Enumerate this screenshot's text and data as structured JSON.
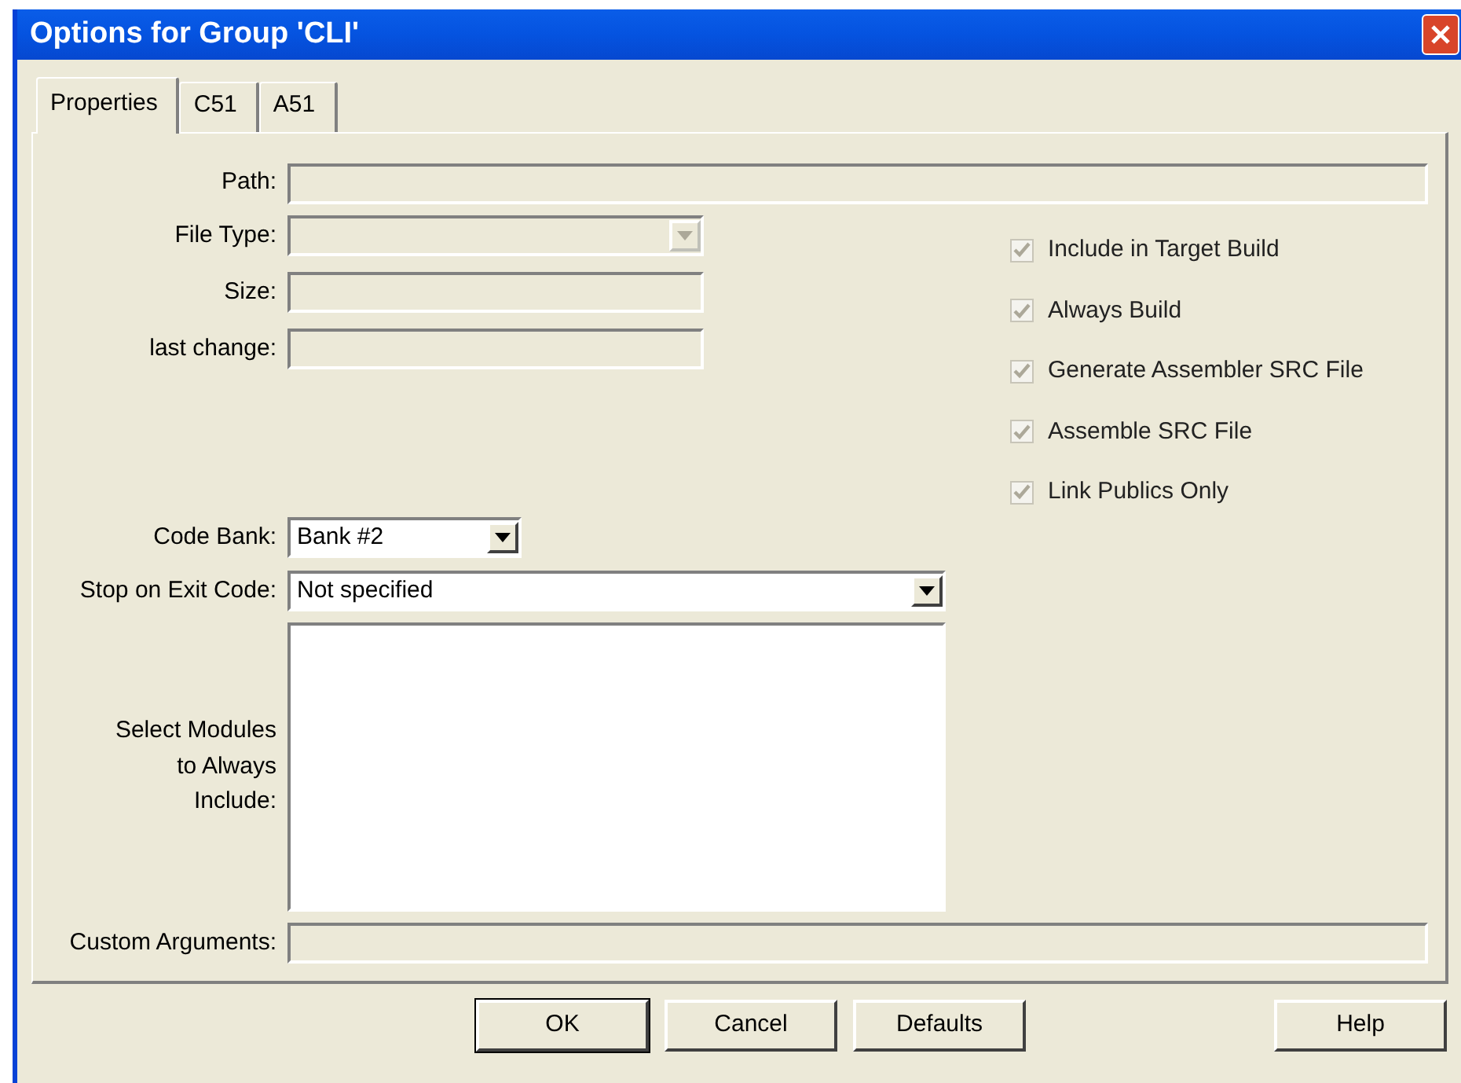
{
  "window": {
    "title": "Options for Group 'CLI'"
  },
  "tabs": [
    {
      "label": "Properties",
      "selected": true
    },
    {
      "label": "C51",
      "selected": false
    },
    {
      "label": "A51",
      "selected": false
    }
  ],
  "path": {
    "label": "Path:",
    "disabled": true
  },
  "fields": [
    {
      "kind": "combo",
      "label": "File Type:",
      "disabled": true
    },
    {
      "kind": "text",
      "label": "Size:",
      "disabled": true
    },
    {
      "kind": "text",
      "label": "last change:",
      "disabled": true
    },
    {
      "kind": "combo",
      "label": "Code Bank:",
      "value": "Bank #2",
      "disabled": false
    },
    {
      "kind": "combo",
      "label": "Stop on Exit Code:",
      "value": "Not specified",
      "disabled": false
    },
    {
      "kind": "list",
      "label": "Select Modules to Always Include:",
      "disabled": false
    }
  ],
  "checkboxes": [
    {
      "label": "Include in Target Build",
      "checked": true,
      "disabled": true
    },
    {
      "label": "Always Build",
      "checked": true,
      "disabled": true
    },
    {
      "label": "Generate Assembler SRC File",
      "checked": true,
      "disabled": true
    },
    {
      "label": "Assemble SRC File",
      "checked": true,
      "disabled": true
    },
    {
      "label": "Link Publics Only",
      "checked": true,
      "disabled": true
    }
  ],
  "custom_arguments": {
    "label": "Custom Arguments:",
    "disabled": true
  },
  "buttons": [
    {
      "label": "OK",
      "default": true
    },
    {
      "label": "Cancel",
      "default": false
    },
    {
      "label": "Defaults",
      "default": false
    }
  ],
  "help_button": {
    "label": "Help"
  }
}
